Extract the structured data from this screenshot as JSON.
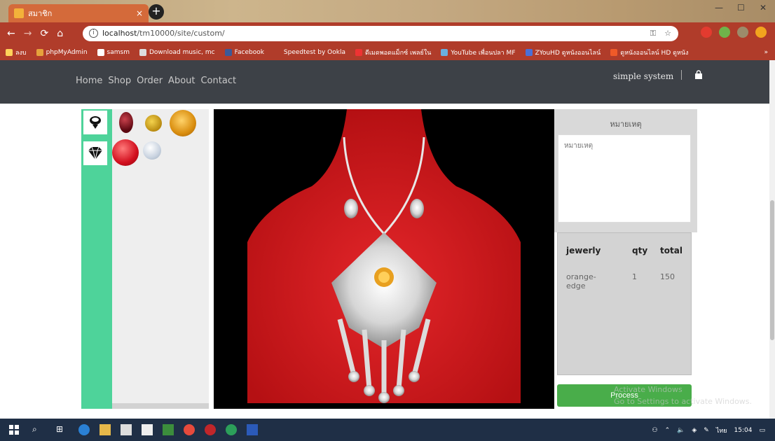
{
  "browser": {
    "tab_title": "สมาชิก",
    "tab_close": "×",
    "new_tab": "+",
    "url_host": "localhost",
    "url_path": "/tm10000/site/custom/",
    "bookmarks": [
      "ลงบ",
      "phpMyAdmin",
      "samsm",
      "Download music, mc",
      "Facebook",
      "Speedtest by Ookla",
      "ดีเมดพอดแม็กซ์ เพลย์ใน",
      "YouTube เพื่อนปลา MF",
      "ZYouHD ดูหนังออนไลน์",
      "ดูหนังออนไลน์ HD ดูหนัง"
    ],
    "bookmarks_more": "»"
  },
  "nav": {
    "links": [
      "Home",
      "Shop",
      "Order",
      "About",
      "Contact"
    ],
    "brand": "simple system"
  },
  "notes": {
    "title": "หมายเหตุ",
    "placeholder": "หมายเหตุ"
  },
  "order": {
    "headers": {
      "jewerly": "jewerly",
      "qty": "qty",
      "total": "total"
    },
    "rows": [
      {
        "jewerly": "orange-edge",
        "qty": "1",
        "total": "150"
      }
    ]
  },
  "process_label": "Process",
  "watermark": {
    "line1": "Activate Windows",
    "line2": "Go to Settings to activate Windows."
  },
  "taskbar": {
    "tray_language": "ไทย",
    "clock": "15:04"
  },
  "colors": {
    "navbar": "#3d4147",
    "category_strip": "#4ed39a",
    "process_button": "#49ad4a",
    "mannequin": "#d81f22"
  }
}
